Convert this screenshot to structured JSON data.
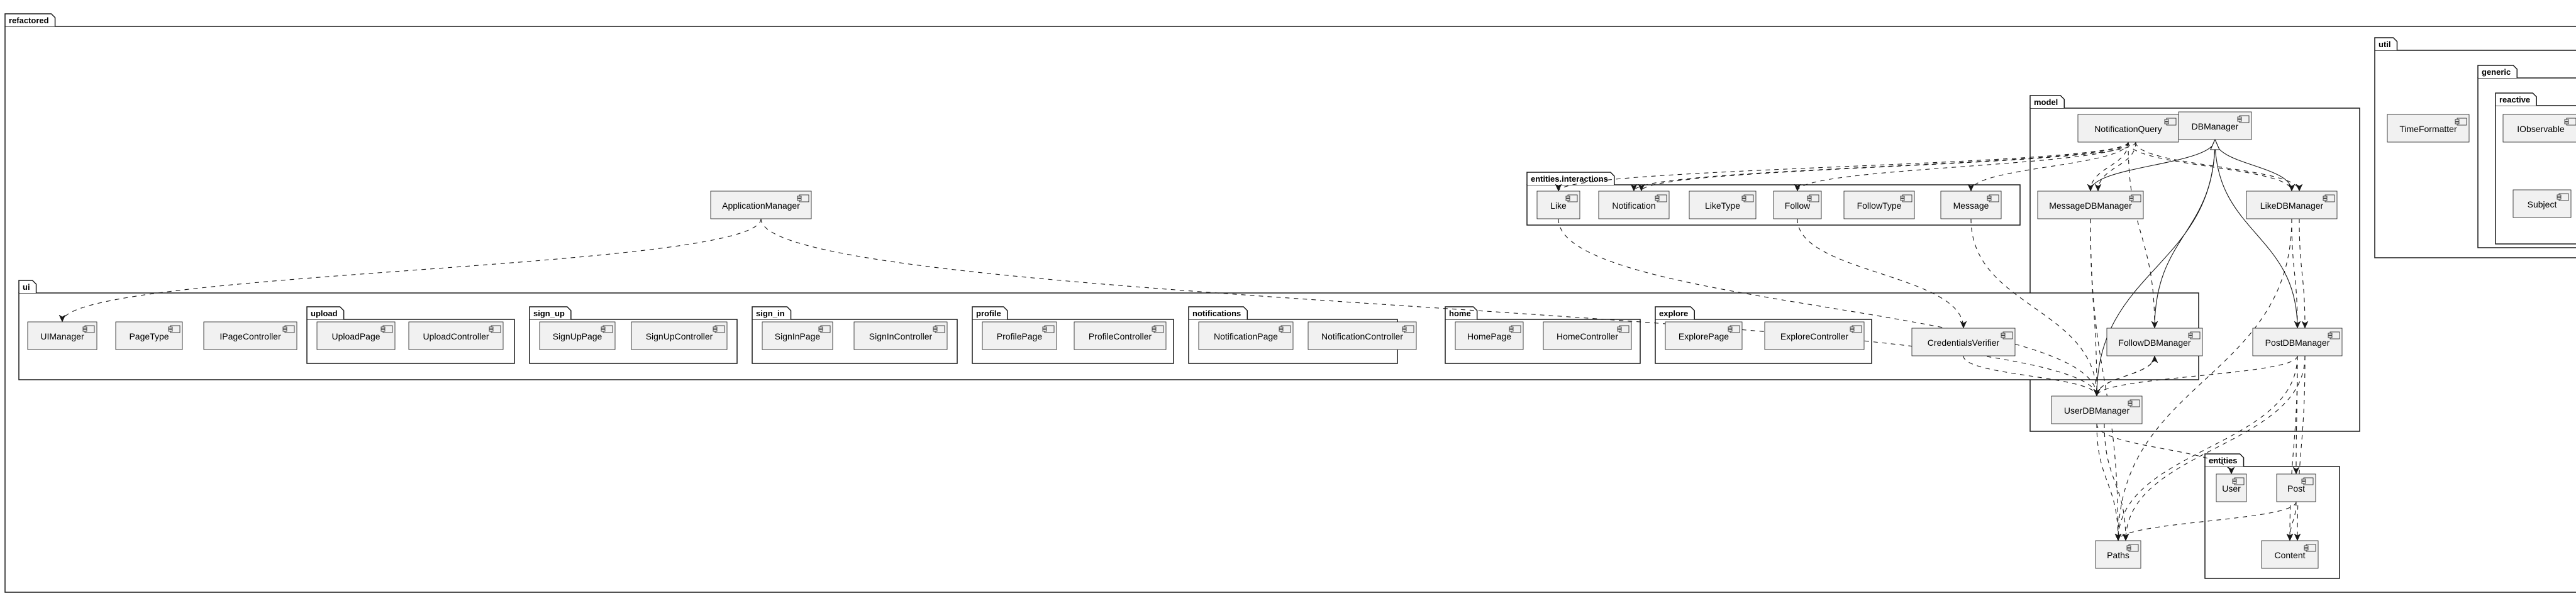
{
  "packages": [
    {
      "id": "refactored",
      "label": "refactored"
    },
    {
      "id": "util",
      "label": "util"
    },
    {
      "id": "generic",
      "label": "generic"
    },
    {
      "id": "reactive",
      "label": "reactive"
    },
    {
      "id": "model",
      "label": "model"
    },
    {
      "id": "interactions",
      "label": "entities.interactions"
    },
    {
      "id": "ui",
      "label": "ui"
    },
    {
      "id": "upload",
      "label": "upload"
    },
    {
      "id": "sign_up",
      "label": "sign_up"
    },
    {
      "id": "sign_in",
      "label": "sign_in"
    },
    {
      "id": "profile",
      "label": "profile"
    },
    {
      "id": "notifications",
      "label": "notifications"
    },
    {
      "id": "home",
      "label": "home"
    },
    {
      "id": "explore",
      "label": "explore"
    },
    {
      "id": "entities",
      "label": "entities"
    }
  ],
  "components": [
    {
      "id": "TimeFormatter",
      "label": "TimeFormatter"
    },
    {
      "id": "IObservable",
      "label": "IObservable"
    },
    {
      "id": "Subject",
      "label": "Subject"
    },
    {
      "id": "ApplicationManager",
      "label": "ApplicationManager"
    },
    {
      "id": "NotificationQuery",
      "label": "NotificationQuery"
    },
    {
      "id": "DBManager",
      "label": "DBManager"
    },
    {
      "id": "MessageDBManager",
      "label": "MessageDBManager"
    },
    {
      "id": "LikeDBManager",
      "label": "LikeDBManager"
    },
    {
      "id": "FollowDBManager",
      "label": "FollowDBManager"
    },
    {
      "id": "PostDBManager",
      "label": "PostDBManager"
    },
    {
      "id": "UserDBManager",
      "label": "UserDBManager"
    },
    {
      "id": "CredentialsVerifier",
      "label": "CredentialsVerifier"
    },
    {
      "id": "Like",
      "label": "Like"
    },
    {
      "id": "Notification",
      "label": "Notification"
    },
    {
      "id": "LikeType",
      "label": "LikeType"
    },
    {
      "id": "Follow",
      "label": "Follow"
    },
    {
      "id": "FollowType",
      "label": "FollowType"
    },
    {
      "id": "Message",
      "label": "Message"
    },
    {
      "id": "UIManager",
      "label": "UIManager"
    },
    {
      "id": "PageType",
      "label": "PageType"
    },
    {
      "id": "IPageController",
      "label": "IPageController"
    },
    {
      "id": "UploadPage",
      "label": "UploadPage"
    },
    {
      "id": "UploadController",
      "label": "UploadController"
    },
    {
      "id": "SignUpPage",
      "label": "SignUpPage"
    },
    {
      "id": "SignUpController",
      "label": "SignUpController"
    },
    {
      "id": "SignInPage",
      "label": "SignInPage"
    },
    {
      "id": "SignInController",
      "label": "SignInController"
    },
    {
      "id": "ProfilePage",
      "label": "ProfilePage"
    },
    {
      "id": "ProfileController",
      "label": "ProfileController"
    },
    {
      "id": "NotificationPage",
      "label": "NotificationPage"
    },
    {
      "id": "NotificationController",
      "label": "NotificationController"
    },
    {
      "id": "HomePage",
      "label": "HomePage"
    },
    {
      "id": "HomeController",
      "label": "HomeController"
    },
    {
      "id": "ExplorePage",
      "label": "ExplorePage"
    },
    {
      "id": "ExploreController",
      "label": "ExploreController"
    },
    {
      "id": "User",
      "label": "User"
    },
    {
      "id": "Post",
      "label": "Post"
    },
    {
      "id": "Content",
      "label": "Content"
    },
    {
      "id": "Paths",
      "label": "Paths"
    }
  ],
  "relations": [
    {
      "from": "ApplicationManager",
      "to": "UIManager",
      "kind": "dependency"
    },
    {
      "from": "ApplicationManager",
      "to": "UserDBManager",
      "kind": "dependency"
    },
    {
      "from": "NotificationQuery",
      "to": "Like",
      "kind": "dependency"
    },
    {
      "from": "NotificationQuery",
      "to": "Notification",
      "kind": "dependency"
    },
    {
      "from": "NotificationQuery",
      "to": "Notification",
      "kind": "dependency"
    },
    {
      "from": "NotificationQuery",
      "to": "Follow",
      "kind": "dependency"
    },
    {
      "from": "NotificationQuery",
      "to": "Message",
      "kind": "dependency"
    },
    {
      "from": "NotificationQuery",
      "to": "MessageDBManager",
      "kind": "dependency"
    },
    {
      "from": "NotificationQuery",
      "to": "MessageDBManager",
      "kind": "dependency"
    },
    {
      "from": "NotificationQuery",
      "to": "LikeDBManager",
      "kind": "dependency"
    },
    {
      "from": "NotificationQuery",
      "to": "LikeDBManager",
      "kind": "dependency"
    },
    {
      "from": "NotificationQuery",
      "to": "FollowDBManager",
      "kind": "dependency"
    },
    {
      "from": "MessageDBManager",
      "to": "DBManager",
      "kind": "inheritance"
    },
    {
      "from": "LikeDBManager",
      "to": "DBManager",
      "kind": "inheritance"
    },
    {
      "from": "FollowDBManager",
      "to": "DBManager",
      "kind": "inheritance"
    },
    {
      "from": "UserDBManager",
      "to": "DBManager",
      "kind": "inheritance"
    },
    {
      "from": "PostDBManager",
      "to": "DBManager",
      "kind": "inheritance"
    },
    {
      "from": "LikeDBManager",
      "to": "PostDBManager",
      "kind": "dependency"
    },
    {
      "from": "LikeDBManager",
      "to": "PostDBManager",
      "kind": "dependency"
    },
    {
      "from": "LikeDBManager",
      "to": "Paths",
      "kind": "dependency"
    },
    {
      "from": "MessageDBManager",
      "to": "UserDBManager",
      "kind": "dependency"
    },
    {
      "from": "MessageDBManager",
      "to": "Paths",
      "kind": "dependency"
    },
    {
      "from": "FollowDBManager",
      "to": "UserDBManager",
      "kind": "dependency"
    },
    {
      "from": "UserDBManager",
      "to": "FollowDBManager",
      "kind": "dependency"
    },
    {
      "from": "Like",
      "to": "UserDBManager",
      "kind": "dependency"
    },
    {
      "from": "Follow",
      "to": "CredentialsVerifier",
      "kind": "dependency"
    },
    {
      "from": "Message",
      "to": "UserDBManager",
      "kind": "dependency"
    },
    {
      "from": "CredentialsVerifier",
      "to": "UserDBManager",
      "kind": "dependency"
    },
    {
      "from": "UserDBManager",
      "to": "Paths",
      "kind": "dependency"
    },
    {
      "from": "UserDBManager",
      "to": "Paths",
      "kind": "dependency"
    },
    {
      "from": "UserDBManager",
      "to": "User",
      "kind": "dependency"
    },
    {
      "from": "PostDBManager",
      "to": "UserDBManager",
      "kind": "dependency"
    },
    {
      "from": "PostDBManager",
      "to": "Paths",
      "kind": "dependency"
    },
    {
      "from": "PostDBManager",
      "to": "Paths",
      "kind": "dependency"
    },
    {
      "from": "PostDBManager",
      "to": "Post",
      "kind": "dependency"
    },
    {
      "from": "PostDBManager",
      "to": "Content",
      "kind": "dependency"
    },
    {
      "from": "PostDBManager",
      "to": "Content",
      "kind": "dependency"
    },
    {
      "from": "Post",
      "to": "Paths",
      "kind": "dependency"
    },
    {
      "from": "Post",
      "to": "Content",
      "kind": "dependency"
    }
  ]
}
